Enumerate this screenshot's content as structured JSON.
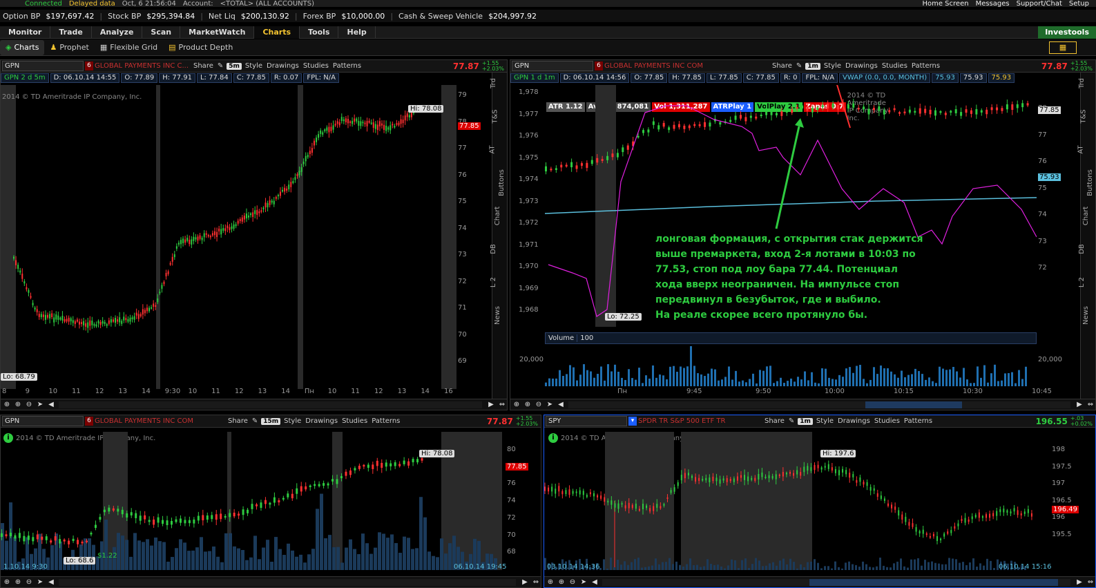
{
  "topbar": {
    "connection": "Connected",
    "data_mode": "Delayed data",
    "datetime": "Oct, 6  21:56:04",
    "account_label": "Account:",
    "account_value": "<TOTAL> (ALL ACCOUNTS)",
    "home": "Home Screen",
    "messages": "Messages",
    "support": "Support/Chat",
    "setup": "Setup"
  },
  "status": {
    "option_bp_label": "Option BP",
    "option_bp": "$197,697.42",
    "stock_bp_label": "Stock BP",
    "stock_bp": "$295,394.84",
    "net_liq_label": "Net Liq",
    "net_liq": "$200,130.92",
    "forex_bp_label": "Forex BP",
    "forex_bp": "$10,000.00",
    "cash_label": "Cash & Sweep Vehicle",
    "cash": "$204,997.92"
  },
  "tabs": [
    "Monitor",
    "Trade",
    "Analyze",
    "Scan",
    "MarketWatch",
    "Charts",
    "Tools",
    "Help"
  ],
  "brand": "Investools",
  "subtabs": [
    "Charts",
    "Prophet",
    "Flexible Grid",
    "Product Depth"
  ],
  "toolbar": {
    "share": "Share",
    "style": "Style",
    "drawings": "Drawings",
    "studies": "Studies",
    "patterns": "Patterns"
  },
  "side_tabs": [
    "Trd",
    "T&S",
    "AT",
    "Buttons",
    "Chart",
    "DB",
    "L 2",
    "News"
  ],
  "copyright": "2014 © TD Ameritrade IP Company, Inc.",
  "colors": {
    "up": "#2ecc40",
    "down": "#ff3030",
    "vwap": "#5bc0de",
    "magenta": "#e020e0",
    "annotation": "#2ecc40"
  },
  "charts": [
    {
      "symbol": "GPN",
      "desc": "GLOBAL PAYMENTS INC C...",
      "timeframe": "5m",
      "price": "77.87",
      "chg1": "+1.55",
      "chg2": "+2.03%",
      "label": "GPN 2 d 5m",
      "info": [
        "D: 06.10.14 14:55",
        "O: 77.89",
        "H: 77.91",
        "L: 77.84",
        "C: 77.85",
        "R: 0.07",
        "FPL: N/A"
      ],
      "y_ticks": [
        "79",
        "78",
        "77",
        "76",
        "75",
        "74",
        "73",
        "72",
        "71",
        "70",
        "69"
      ],
      "x_ticks": [
        "8",
        "9",
        "10",
        "11",
        "12",
        "13",
        "14",
        "9:30",
        "10",
        "11",
        "12",
        "13",
        "14",
        "Пн",
        "10",
        "11",
        "12",
        "13",
        "14",
        "16"
      ],
      "hi": "Hi: 78.08",
      "lo": "Lo: 68.79",
      "last": "77.85"
    },
    {
      "symbol": "GPN",
      "desc": "GLOBAL PAYMENTS INC COM",
      "timeframe": "1m",
      "price": "77.87",
      "chg1": "+1.55",
      "chg2": "+2.03%",
      "label": "GPN 1 d 1m",
      "info": [
        "D: 06.10.14 14:56",
        "O: 77.85",
        "H: 77.85",
        "L: 77.85",
        "C: 77.85",
        "R: 0",
        "FPL: N/A"
      ],
      "vwap": "VWAP (0.0, 0.0, MONTH)",
      "vwap_vals": [
        "75.93",
        "75.93",
        "75.93"
      ],
      "indicators": {
        "atr": "ATR 1.12",
        "avgvol": "AvgVol 874,081",
        "vol": "Vol 1,311,287",
        "atrplay": "ATRPlay 1",
        "volplay": "VolPlay 2.1",
        "zapas": "Zapas 0.7"
      },
      "y_left": [
        "1,978",
        "1,977",
        "1,976",
        "1,975",
        "1,974",
        "1,973",
        "1,972",
        "1,971",
        "1,970",
        "1,969",
        "1,968"
      ],
      "y_right": [
        "78",
        "77",
        "76",
        "75",
        "74",
        "73",
        "72"
      ],
      "x_ticks": [
        "Пн",
        "9:45",
        "9:50",
        "10:00",
        "10:15",
        "10:30",
        "10:45"
      ],
      "lo": "Lo: 72.25",
      "last": "77.85",
      "vwap_box": "75.93",
      "volume_label": "Volume",
      "volume_value": "100",
      "vol_tick": "20,000",
      "annotation": "лонговая формация, с открытия стак держится\nвыше премаркета, вход 2-я лотами в 10:03 по\n77.53, стоп под лоу бара 77.44. Потенциал\nхода вверх неограничен. На импульсе стоп\nпередвинул в безубыток, где и выбило.\nНа реале скорее всего протянуло бы."
    },
    {
      "symbol": "GPN",
      "desc": "GLOBAL PAYMENTS INC COM",
      "timeframe": "15m",
      "price": "77.87",
      "chg1": "+1.55",
      "chg2": "+2.03%",
      "y_ticks": [
        "80",
        "78",
        "76",
        "74",
        "72",
        "70",
        "68"
      ],
      "hi": "Hi: 78.08",
      "lo": "Lo: 68.6",
      "last": "77.85",
      "start_date": "1.10.14 9:30",
      "end_date": "06.10.14 19:45",
      "badge": "$1.22"
    },
    {
      "symbol": "SPY",
      "desc": "SPDR TR S&P 500 ETF TR",
      "timeframe": "1m",
      "price": "196.55",
      "chg1": "+.03",
      "chg2": "+0.02%",
      "y_ticks": [
        "198",
        "197.5",
        "197",
        "196.5",
        "196",
        "195.5"
      ],
      "hi": "Hi: 197.6",
      "last": "196.49",
      "start_date": "03.10.14 14:36",
      "end_date": "06.10.14 15:16"
    }
  ]
}
